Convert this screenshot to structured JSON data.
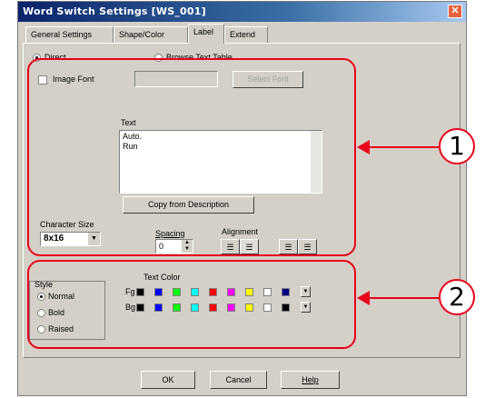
{
  "window": {
    "title": "Word Switch Settings [WS_001]",
    "close_glyph": "✕"
  },
  "tabs": [
    {
      "label": "General Settings"
    },
    {
      "label": "Shape/Color"
    },
    {
      "label": "Label"
    },
    {
      "label": "Extend"
    }
  ],
  "label_tab": {
    "direct_label": "Direct",
    "browse_label": "Browse Text Table",
    "image_font_label": "Image Font",
    "select_font_label": "Select Font",
    "text_label": "Text",
    "text_value": "Auto.\nRun",
    "copy_button": "Copy from Description",
    "char_size_label": "Character Size",
    "char_size_value": "8x16",
    "spacing_label": "Spacing",
    "spacing_value": "0",
    "alignment_label": "Alignment"
  },
  "style": {
    "group_label": "Style",
    "options": [
      {
        "label": "Normal",
        "selected": true
      },
      {
        "label": "Bold",
        "selected": false
      },
      {
        "label": "Raised",
        "selected": false
      }
    ],
    "text_color_label": "Text Color",
    "fg_label": "Fg",
    "bg_label": "Bg",
    "fg_colors": [
      "#000000",
      "#0000ff",
      "#00ff00",
      "#00ffff",
      "#ff0000",
      "#ff00ff",
      "#ffff00",
      "#ffffff",
      "#000080"
    ],
    "bg_colors": [
      "#000000",
      "#0000ff",
      "#00ff00",
      "#00ffff",
      "#ff0000",
      "#ff00ff",
      "#ffff00",
      "#ffffff",
      "#000000"
    ]
  },
  "buttons": {
    "ok": "OK",
    "cancel": "Cancel",
    "help": "Help"
  },
  "callouts": {
    "one": "1",
    "two": "2"
  },
  "colors": {
    "callout": "#e8001a",
    "title_bar": "#0a246a"
  }
}
